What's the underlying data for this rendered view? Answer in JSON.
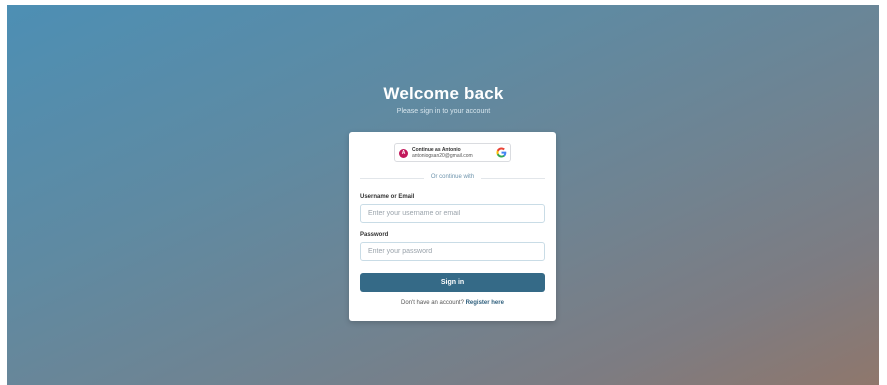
{
  "header": {
    "title": "Welcome back",
    "subtitle": "Please sign in to your account"
  },
  "google": {
    "avatar_initial": "A",
    "name": "Continue as Antonio",
    "email": "antoniogsan20@gmail.com",
    "icon": "google-icon"
  },
  "divider_text": "Or continue with",
  "form": {
    "username_label": "Username or Email",
    "username_placeholder": "Enter your username or email",
    "password_label": "Password",
    "password_placeholder": "Enter your password",
    "submit_label": "Sign in"
  },
  "footer": {
    "prompt": "Don't have an account?",
    "register_link": "Register here"
  },
  "colors": {
    "accent": "#356a87",
    "link": "#2f5f7d",
    "avatar": "#c2185b"
  }
}
